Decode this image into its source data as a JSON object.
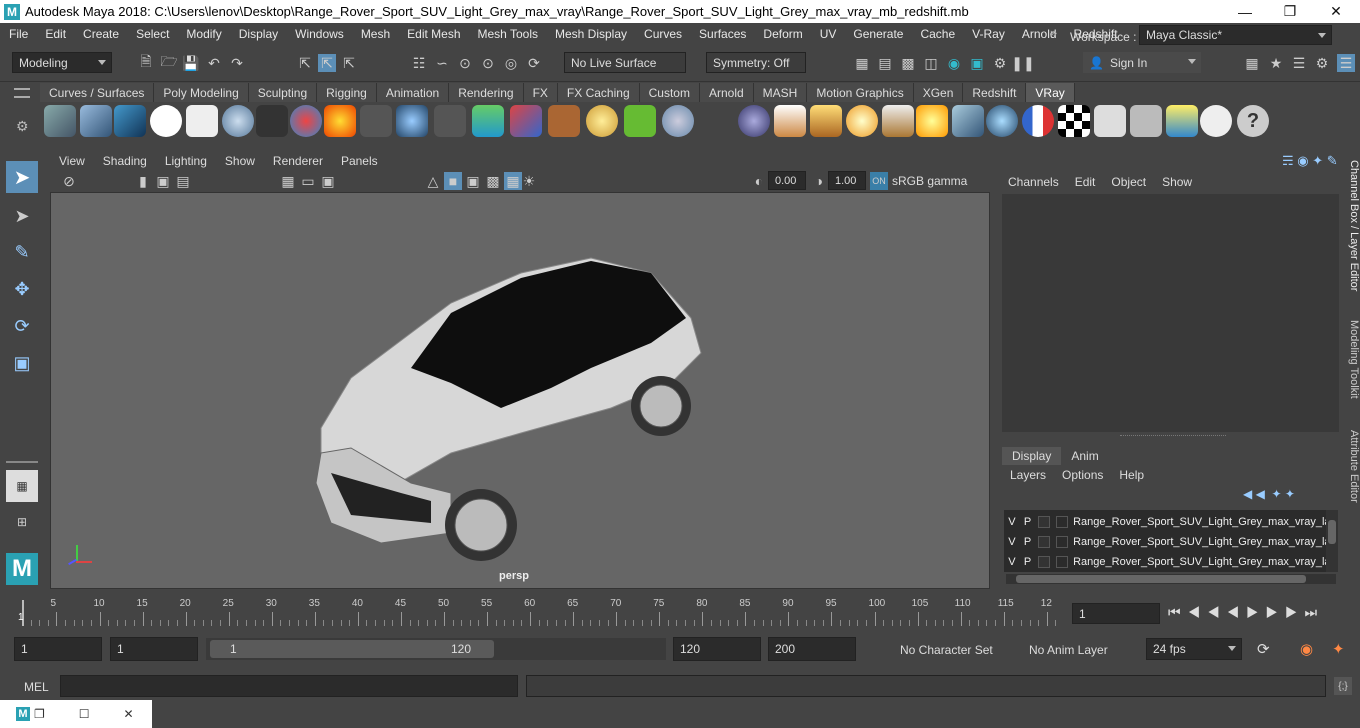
{
  "window": {
    "title": "Autodesk Maya 2018: C:\\Users\\lenov\\Desktop\\Range_Rover_Sport_SUV_Light_Grey_max_vray\\Range_Rover_Sport_SUV_Light_Grey_max_vray_mb_redshift.mb",
    "logo": "M"
  },
  "menu": [
    "File",
    "Edit",
    "Create",
    "Select",
    "Modify",
    "Display",
    "Windows",
    "Mesh",
    "Edit Mesh",
    "Mesh Tools",
    "Mesh Display",
    "Curves",
    "Surfaces",
    "Deform",
    "UV",
    "Generate",
    "Cache",
    "V-Ray",
    "Arnold",
    "Redshift"
  ],
  "workspace": {
    "label": "Workspace :",
    "value": "Maya Classic*"
  },
  "statusline": {
    "mode": "Modeling",
    "live_surface": "No Live Surface",
    "symmetry": "Symmetry: Off",
    "sign_in": "Sign In"
  },
  "shelf_tabs": [
    "Curves / Surfaces",
    "Poly Modeling",
    "Sculpting",
    "Rigging",
    "Animation",
    "Rendering",
    "FX",
    "FX Caching",
    "Custom",
    "Arnold",
    "MASH",
    "Motion Graphics",
    "XGen",
    "Redshift",
    "VRay"
  ],
  "active_shelf": "VRay",
  "viewport": {
    "menu": [
      "View",
      "Shading",
      "Lighting",
      "Show",
      "Renderer",
      "Panels"
    ],
    "exposure": "0.00",
    "gamma": "1.00",
    "color_space": "sRGB gamma",
    "camera": "persp"
  },
  "channel_box": {
    "menu": [
      "Channels",
      "Edit",
      "Object",
      "Show"
    ]
  },
  "side_tabs": [
    "Channel Box / Layer Editor",
    "Modeling Toolkit",
    "Attribute Editor"
  ],
  "layer_editor": {
    "tabs": [
      "Display",
      "Anim"
    ],
    "menu": [
      "Layers",
      "Options",
      "Help"
    ],
    "layers": [
      {
        "v": "V",
        "p": "P",
        "name": "Range_Rover_Sport_SUV_Light_Grey_max_vray_la"
      },
      {
        "v": "V",
        "p": "P",
        "name": "Range_Rover_Sport_SUV_Light_Grey_max_vray_la"
      },
      {
        "v": "V",
        "p": "P",
        "name": "Range_Rover_Sport_SUV_Light_Grey_max_vray_la"
      }
    ]
  },
  "timeline": {
    "ticks": [
      "5",
      "10",
      "15",
      "20",
      "25",
      "30",
      "35",
      "40",
      "45",
      "50",
      "55",
      "60",
      "65",
      "70",
      "75",
      "80",
      "85",
      "90",
      "95",
      "100",
      "105",
      "110",
      "115",
      "12"
    ],
    "start_marker": "1",
    "current_frame": "1"
  },
  "range": {
    "start": "1",
    "playback_start": "1",
    "slider_start": "1",
    "slider_end": "120",
    "playback_end": "120",
    "end": "200",
    "character_set": "No Character Set",
    "anim_layer": "No Anim Layer",
    "fps": "24 fps"
  },
  "command_line": {
    "label": "MEL"
  }
}
